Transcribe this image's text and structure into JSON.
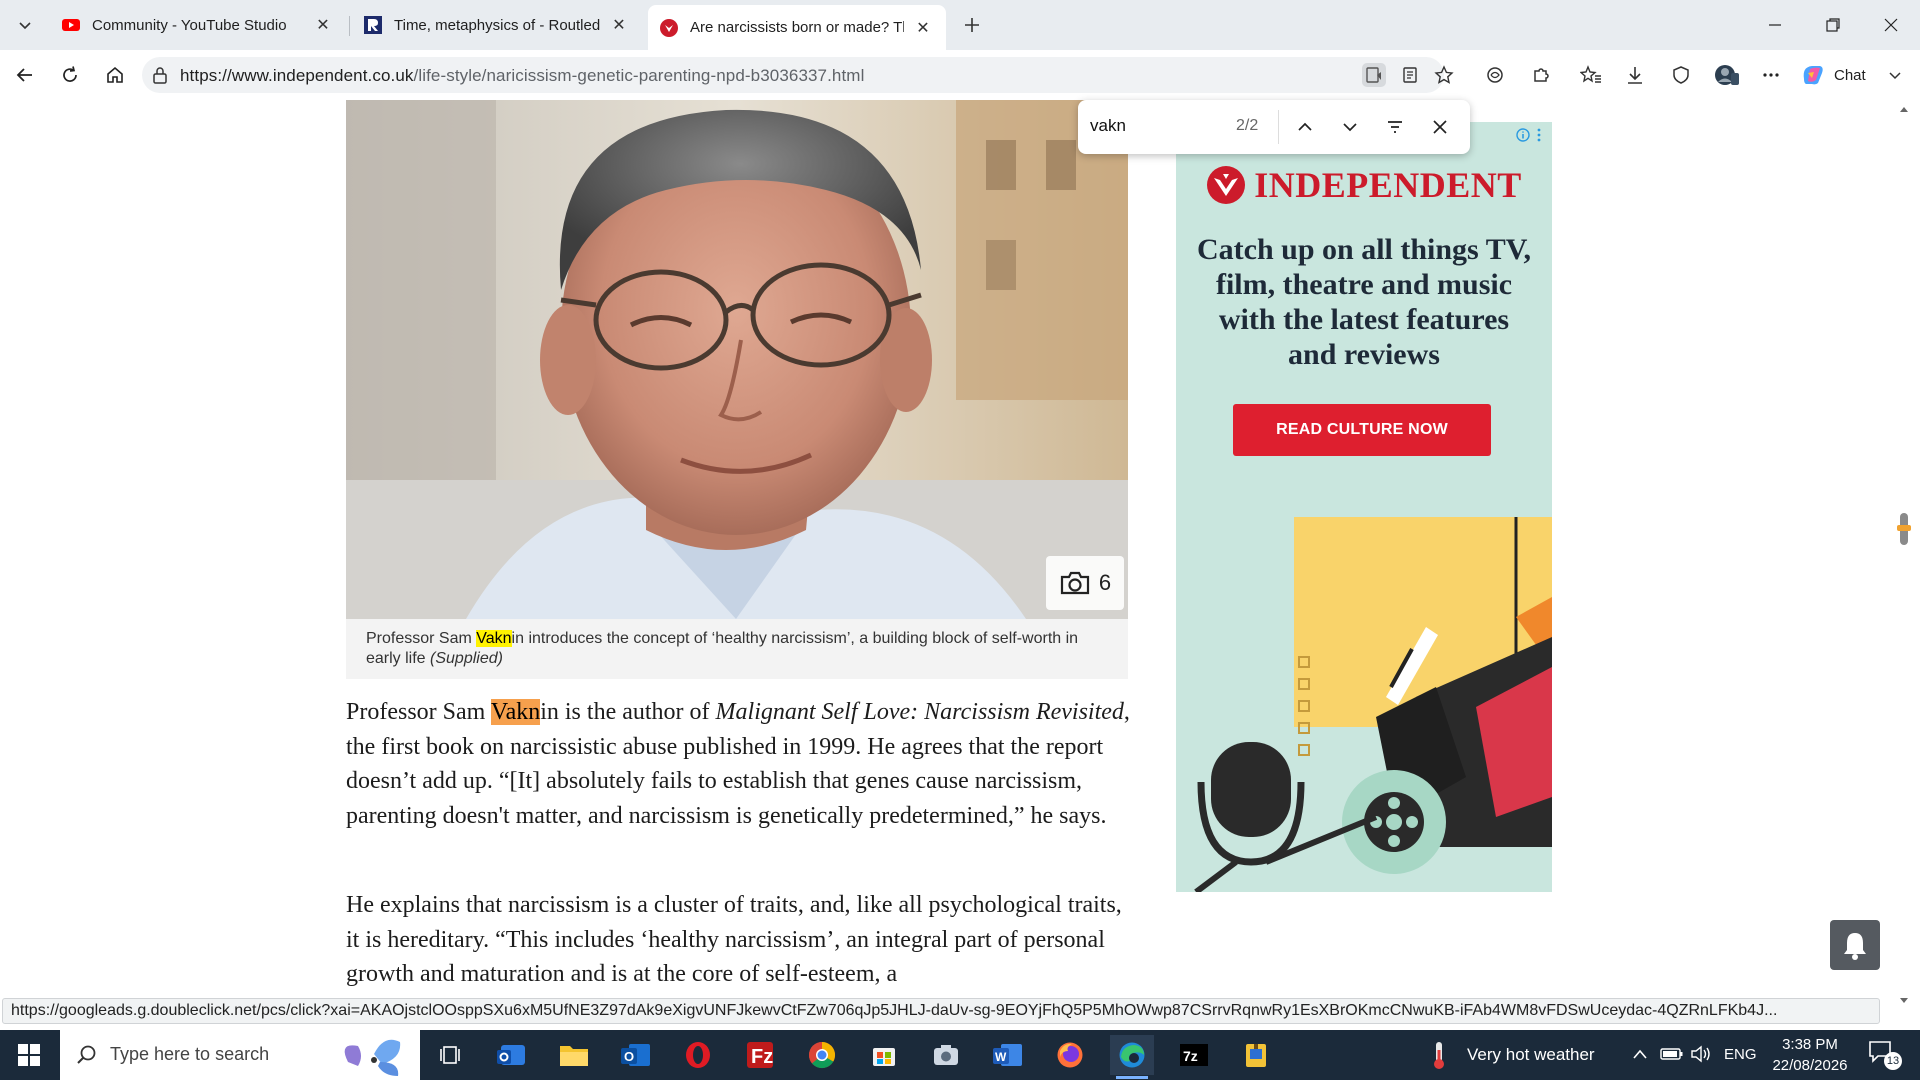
{
  "browser": {
    "tabs": [
      {
        "title": "Community - YouTube Studio",
        "favicon": "youtube-icon",
        "active": false
      },
      {
        "title": "Time, metaphysics of - Routledge E",
        "favicon": "routledge-icon",
        "active": false
      },
      {
        "title": "Are narcissists born or made? The",
        "favicon": "independent-icon",
        "active": true
      }
    ],
    "url": {
      "host": "https://www.independent.co.uk",
      "path": "/life-style/naricissism-genetic-parenting-npd-b3036337.html"
    },
    "chat_label": "Chat"
  },
  "find_bar": {
    "query": "vakn",
    "count": "2/2"
  },
  "article": {
    "photo_count": "6",
    "caption": {
      "before": "Professor Sam ",
      "match": "Vakn",
      "after": "in introduces the concept of ‘healthy narcissism’, a building block of self-worth in early life",
      "credit": "(Supplied)"
    },
    "p1": {
      "before": "Professor Sam ",
      "match": "Vakn",
      "mid": "in is the author of ",
      "book": "Malignant Self Love: Narcissism Revisited",
      "after": ", the first book on narcissistic abuse published in 1999. He agrees that the report doesn’t add up. “[It] absolutely fails to establish that genes cause narcissism, parenting doesn't matter, and narcissism is genetically predetermined,” he says."
    },
    "p2": "He explains that narcissism is a cluster of traits, and, like all psychological traits, it is hereditary. “This includes ‘healthy narcissism’, an integral part of personal growth and maturation and is at the core of self-esteem, a"
  },
  "ad": {
    "brand": "INDEPENDENT",
    "headline": "Catch up on all things TV, film, theatre and music with the latest features and reviews",
    "cta": "READ CULTURE NOW"
  },
  "status_url": "https://googleads.g.doubleclick.net/pcs/click?xai=AKAOjstclOOsppSXu6xM5UfNE3Z97dAk9eXigvUNFJkewvCtFZw706qJp5JHLJ-daUv-sg-9EOYjFhQ5P5MhOWwp87CSrrvRqnwRy1EsXBrOKmcCNwuKB-iFAb4WM8vFDSwUceydac-4QZRnLFKb4J...",
  "taskbar": {
    "search_placeholder": "Type here to search",
    "weather": "Very hot weather",
    "language": "ENG",
    "time": "3:38 PM",
    "date": "22/08/2026",
    "notification_count": "13"
  },
  "colors": {
    "accent_red": "#de1f2f",
    "brand_red": "#cc1b2b",
    "ad_bg": "#c9e6de",
    "find_highlight": "#fff200",
    "current_match": "#f6a04d"
  }
}
